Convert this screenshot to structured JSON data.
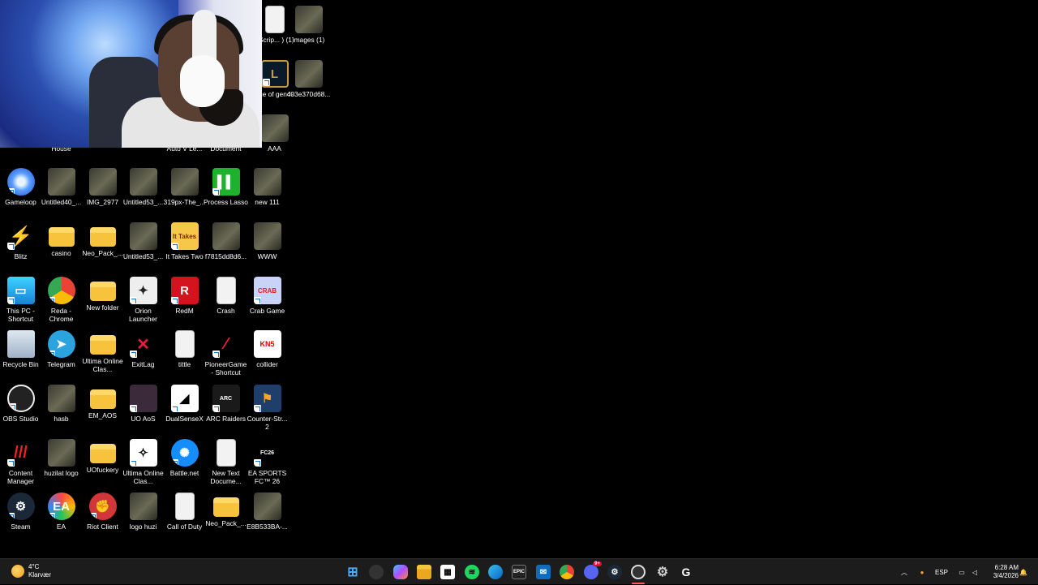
{
  "desktop": {
    "background_color": "#000000",
    "icons": [
      {
        "label": "_Scrip... ) (1)",
        "icon": "file-icon"
      },
      {
        "label": "images (1)",
        "icon": "image-icon"
      },
      {
        "label": "gue of gends",
        "icon": "league-of-legends-icon"
      },
      {
        "label": "403e370d68...",
        "icon": "image-icon"
      },
      {
        "label": "AAA",
        "icon": "image-icon"
      },
      {
        "label": "House",
        "icon": "image-icon"
      },
      {
        "label": "Auto V Le...",
        "icon": "file-icon"
      },
      {
        "label": "Document",
        "icon": "document-icon"
      },
      {
        "label": "Gameloop",
        "icon": "gameloop-icon"
      },
      {
        "label": "Untitled40_...",
        "icon": "image-icon"
      },
      {
        "label": "IMG_2977",
        "icon": "image-icon"
      },
      {
        "label": "Untitled53_...",
        "icon": "image-icon"
      },
      {
        "label": "319px-The_...",
        "icon": "image-icon"
      },
      {
        "label": "Process Lasso",
        "icon": "process-lasso-icon"
      },
      {
        "label": "new 111",
        "icon": "image-icon"
      },
      {
        "label": "Blitz",
        "icon": "blitz-icon"
      },
      {
        "label": "casino",
        "icon": "folder-icon"
      },
      {
        "label": "Neo_Pack_...",
        "icon": "folder-icon"
      },
      {
        "label": "Untitled53_...",
        "icon": "image-icon"
      },
      {
        "label": "It Takes Two",
        "icon": "it-takes-two-icon"
      },
      {
        "label": "f7815dd8d6...",
        "icon": "image-icon"
      },
      {
        "label": "WWW",
        "icon": "image-icon"
      },
      {
        "label": "This PC - Shortcut",
        "icon": "this-pc-icon"
      },
      {
        "label": "Reda - Chrome",
        "icon": "chrome-icon"
      },
      {
        "label": "New folder",
        "icon": "folder-icon"
      },
      {
        "label": "Orion Launcher",
        "icon": "orion-launcher-icon"
      },
      {
        "label": "RedM",
        "icon": "redm-icon"
      },
      {
        "label": "Crash",
        "icon": "file-icon"
      },
      {
        "label": "Crab Game",
        "icon": "crab-game-icon"
      },
      {
        "label": "Recycle Bin",
        "icon": "recycle-bin-icon"
      },
      {
        "label": "Telegram",
        "icon": "telegram-icon"
      },
      {
        "label": "Ultima Online Clas...",
        "icon": "folder-icon"
      },
      {
        "label": "ExitLag",
        "icon": "exitlag-icon"
      },
      {
        "label": "tittle",
        "icon": "text-file-icon"
      },
      {
        "label": "PioneerGame - Shortcut",
        "icon": "pioneer-game-icon"
      },
      {
        "label": "collider",
        "icon": "collider-icon"
      },
      {
        "label": "OBS Studio",
        "icon": "obs-icon"
      },
      {
        "label": "hasb",
        "icon": "image-icon"
      },
      {
        "label": "EM_AOS",
        "icon": "folder-icon"
      },
      {
        "label": "UO AoS",
        "icon": "uo-aos-icon"
      },
      {
        "label": "DualSenseX",
        "icon": "dualsensex-icon"
      },
      {
        "label": "ARC Raiders",
        "icon": "arc-raiders-icon"
      },
      {
        "label": "Counter-Str... 2",
        "icon": "counter-strike-icon"
      },
      {
        "label": "Content Manager",
        "icon": "content-manager-icon"
      },
      {
        "label": "huzilat logo",
        "icon": "image-icon"
      },
      {
        "label": "UOfuckery",
        "icon": "folder-icon"
      },
      {
        "label": "Ultima Online Clas...",
        "icon": "ultima-online-icon"
      },
      {
        "label": "Battle.net",
        "icon": "battlenet-icon"
      },
      {
        "label": "New Text Docume...",
        "icon": "text-file-icon"
      },
      {
        "label": "EA SPORTS FC™ 26",
        "icon": "ea-fc-icon"
      },
      {
        "label": "Steam",
        "icon": "steam-icon"
      },
      {
        "label": "EA",
        "icon": "ea-icon"
      },
      {
        "label": "Riot Client",
        "icon": "riot-client-icon"
      },
      {
        "label": "logo huzi",
        "icon": "image-icon"
      },
      {
        "label": "Call of Duty",
        "icon": "file-icon"
      },
      {
        "label": "Neo_Pack_...",
        "icon": "folder-icon"
      },
      {
        "label": "E8B533BA-...",
        "icon": "image-icon"
      }
    ]
  },
  "taskbar": {
    "weather": {
      "temp": "4°C",
      "condition": "Klarvær"
    },
    "apps": [
      "start-icon",
      "task-view-icon",
      "copilot-icon",
      "file-explorer-icon",
      "store-icon",
      "spotify-icon",
      "edge-icon",
      "epic-games-icon",
      "outlook-icon",
      "chrome-icon",
      "discord-icon",
      "steam-icon",
      "obs-recording-icon",
      "settings-icon",
      "logitech-g-hub-icon"
    ],
    "discord_badge": "9+",
    "tray": {
      "language": "ESP",
      "time": "6:28 AM",
      "date": "3/4/2026"
    }
  }
}
